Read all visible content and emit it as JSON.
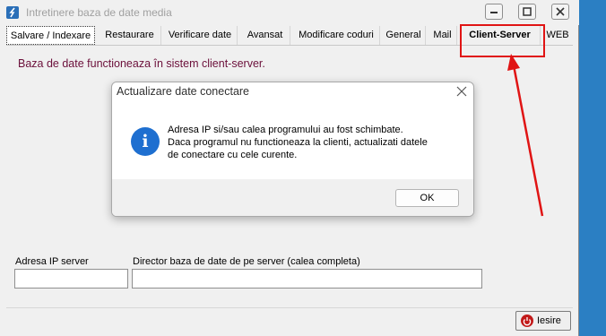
{
  "window": {
    "title": "Intretinere baza de date media",
    "controls": [
      "minimize",
      "maximize",
      "close"
    ]
  },
  "tabs": [
    {
      "label": "Salvare / Indexare",
      "selected": true
    },
    {
      "label": "Restaurare"
    },
    {
      "label": "Verificare date"
    },
    {
      "label": "Avansat"
    },
    {
      "label": "Modificare coduri"
    },
    {
      "label": "General"
    },
    {
      "label": "Mail"
    },
    {
      "label": "Client-Server",
      "highlighted": true
    },
    {
      "label": "WEB"
    }
  ],
  "content": {
    "info_text": "Baza de date functioneaza în sistem client-server.",
    "ip_label": "Adresa IP server",
    "ip_value": "",
    "dir_label": "Director baza de date de pe server (calea completa)",
    "dir_value": ""
  },
  "footer": {
    "exit_label": "Iesire"
  },
  "dialog": {
    "title": "Actualizare date conectare",
    "icon": "info-icon",
    "message_lines": [
      "Adresa IP si/sau calea programului au fost schimbate.",
      "Daca programul nu functioneaza la clienti, actualizati datele",
      "de conectare cu cele curente."
    ],
    "ok_label": "OK"
  },
  "annotation": {
    "color": "#e01414"
  },
  "colors": {
    "desktop": "#2b7fc3",
    "info_text": "#6b0f3a",
    "dialog_icon": "#1e6fd0"
  }
}
